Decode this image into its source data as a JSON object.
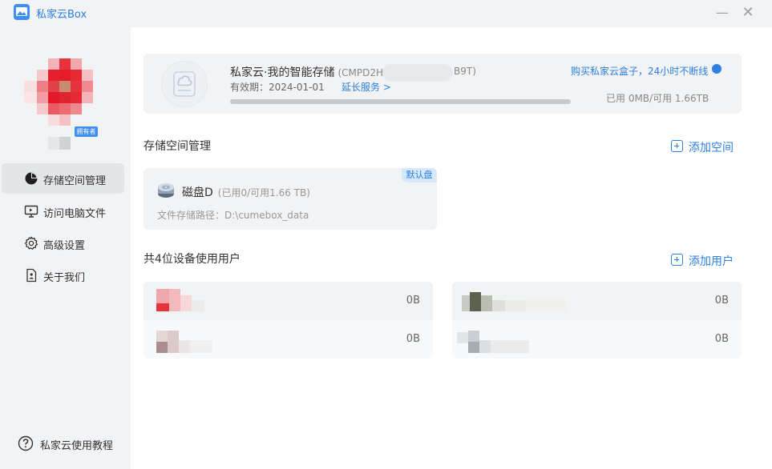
{
  "app": {
    "title": "私家云Box"
  },
  "sidebar": {
    "owner_badge": "拥有者",
    "items": [
      {
        "label": "存储空间管理",
        "active": true,
        "icon": "pie-chart-icon"
      },
      {
        "label": "访问电脑文件",
        "active": false,
        "icon": "monitor-icon"
      },
      {
        "label": "高级设置",
        "active": false,
        "icon": "gear-icon"
      },
      {
        "label": "关于我们",
        "active": false,
        "icon": "info-doc-icon"
      }
    ],
    "help_label": "私家云使用教程"
  },
  "device": {
    "name": "私家云·我的智能存储",
    "serial_prefix": "(CMPD2H",
    "serial_suffix": "B9T)",
    "expiry": "有效期：2024-01-01",
    "extend_label": "延长服务 >",
    "buy_label": "购买私家云盒子，24小时不断线",
    "usage": "已用 0MB/可用 1.66TB",
    "used_fraction": 0.0
  },
  "storage": {
    "section_title": "存储空间管理",
    "add_label": "添加空间",
    "disk": {
      "name": "磁盘D",
      "usage": "(已用0/可用1.66 TB)",
      "path": "文件存储路径：D:\\cumebox_data",
      "badge": "默认盘"
    }
  },
  "users": {
    "section_title": "共4位设备使用用户",
    "add_label": "添加用户",
    "list": [
      {
        "size": "0B"
      },
      {
        "size": "0B"
      },
      {
        "size": "0B"
      },
      {
        "size": "0B"
      }
    ]
  },
  "colors": {
    "accent": "#2d7fe0",
    "sidebar_bg": "#f2f3f5"
  }
}
